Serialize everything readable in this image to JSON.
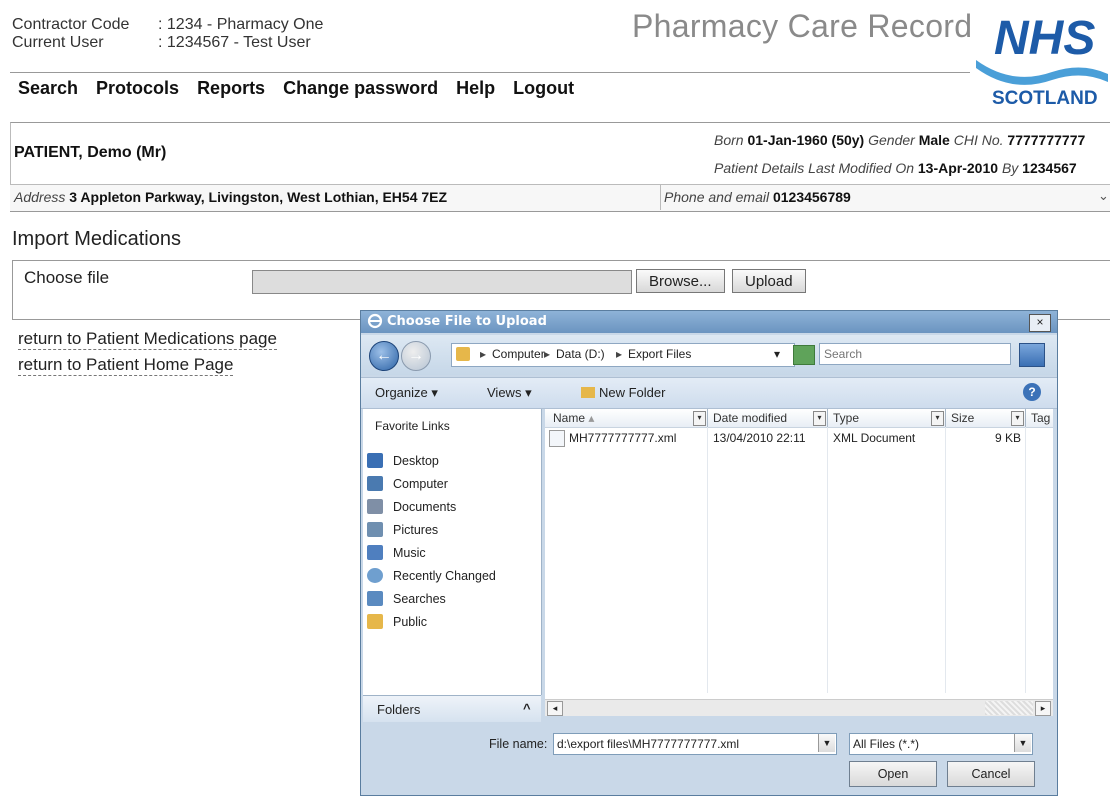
{
  "header": {
    "contractor_code_label": "Contractor Code",
    "contractor_code_value": ": 1234 - Pharmacy One",
    "current_user_label": "Current User",
    "current_user_value": ": 1234567 - Test User",
    "app_title": "Pharmacy Care Record",
    "logo_top": "NHS",
    "logo_bottom": "SCOTLAND"
  },
  "nav": [
    "Search",
    "Protocols",
    "Reports",
    "Change password",
    "Help",
    "Logout"
  ],
  "patient": {
    "name": "PATIENT, Demo (Mr)",
    "born_label": "Born",
    "born_value": "01-Jan-1960",
    "age": "(50y)",
    "gender_label": "Gender",
    "gender_value": "Male",
    "chi_label": "CHI No.",
    "chi_value": "7777777777",
    "modified_label": "Patient Details Last Modified On",
    "modified_value": "13-Apr-2010",
    "by_label": "By",
    "by_value": "1234567",
    "address_label": "Address",
    "address_value": "3 Appleton Parkway, Livingston, West Lothian, EH54 7EZ",
    "phone_label": "Phone and email",
    "phone_value": "0123456789"
  },
  "import": {
    "title": "Import Medications",
    "choose_label": "Choose file",
    "browse_label": "Browse...",
    "upload_label": "Upload",
    "link_medications": "return to Patient Medications page",
    "link_home": "return to Patient Home Page"
  },
  "dialog": {
    "title": "Choose File to Upload",
    "close_label": "×",
    "crumbs": [
      "Computer",
      "Data (D:)",
      "Export Files"
    ],
    "search_placeholder": "Search",
    "toolbar": {
      "organize": "Organize",
      "views": "Views",
      "new_folder": "New Folder"
    },
    "favorites_title": "Favorite Links",
    "favorites": [
      {
        "label": "Desktop",
        "icon": "desktop-icon",
        "color": "#3a6fb4"
      },
      {
        "label": "Computer",
        "icon": "computer-icon",
        "color": "#4a7ab0"
      },
      {
        "label": "Documents",
        "icon": "documents-icon",
        "color": "#7f8fa6"
      },
      {
        "label": "Pictures",
        "icon": "pictures-icon",
        "color": "#6f8fb0"
      },
      {
        "label": "Music",
        "icon": "music-icon",
        "color": "#4f7fbf"
      },
      {
        "label": "Recently Changed",
        "icon": "recently-changed-icon",
        "color": "#6f9fcf"
      },
      {
        "label": "Searches",
        "icon": "searches-icon",
        "color": "#5a8ac0"
      },
      {
        "label": "Public",
        "icon": "public-icon",
        "color": "#e6b74a"
      }
    ],
    "folders_label": "Folders",
    "columns": [
      "Name",
      "Date modified",
      "Type",
      "Size",
      "Tag"
    ],
    "files": [
      {
        "name": "MH7777777777.xml",
        "date": "13/04/2010 22:11",
        "type": "XML Document",
        "size": "9 KB"
      }
    ],
    "filename_label": "File name:",
    "filename_value": "d:\\export files\\MH7777777777.xml",
    "filter_value": "All Files (*.*)",
    "open_label": "Open",
    "cancel_label": "Cancel"
  }
}
